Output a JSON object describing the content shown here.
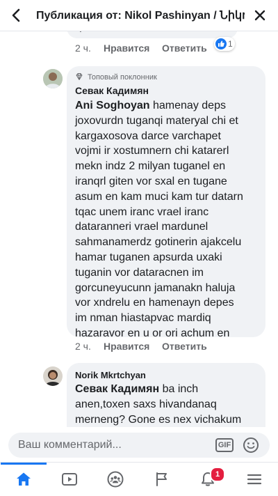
{
  "header": {
    "title": "Публикация от: Nikol Pashinyan / Նիկո..."
  },
  "top_fragment": {
    "snippet": "ր",
    "time": "2 ч.",
    "like_label": "Нравится",
    "reply_label": "Ответить",
    "reaction_count": "1"
  },
  "comment_1": {
    "badge": "Топовый поклонник",
    "author": "Севак Кадимян",
    "mention": "Ani Soghoyan",
    "lines": [
      " hamenay deps",
      "joxovurdn tuganqi materyal chi et",
      "kargaxosova darce varchapet",
      "vojmi ir xostumnern chi katarerl",
      "mekn indz 2 milyan tuganel en",
      "iranqrl giten vor sxal en tugane",
      "asum en kam muci kam tur datarn",
      "tqac unem iranc vrael iranc",
      "dataranneri vrael mardunel",
      "sahmanamerdz gotinerin ajakcelu",
      "hamar tuganen apsurda uxaki",
      "tuganin vor dataracnen im",
      "gorcuneyucunn jamanakn haluja",
      "vor xndrelu en hamenayn depes",
      "im nman hiastapvac mardiq",
      "hazaravor en u or ori achum en"
    ],
    "time": "2 ч.",
    "like_label": "Нравится",
    "reply_label": "Ответить"
  },
  "comment_2": {
    "author": "Norik Mkrtchyan",
    "mention": "Севак Кадимян",
    "lines": [
      " ba inch",
      "anen,toxen saxs hivandanaq",
      "merneng? Gone es nex vichakum"
    ]
  },
  "composer": {
    "placeholder": "Ваш комментарий...",
    "gif_label": "GIF"
  },
  "tabs": {
    "notifications_count": "1",
    "icons": [
      "home-icon",
      "watch-icon",
      "groups-icon",
      "pages-flag-icon",
      "notifications-icon",
      "menu-icon"
    ]
  },
  "colors": {
    "accent": "#1877f2",
    "bubble": "#f0f2f5",
    "badge_red": "#e41e3f",
    "muted": "#65676b"
  }
}
